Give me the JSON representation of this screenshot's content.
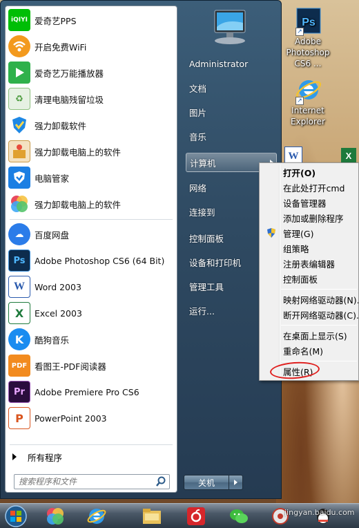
{
  "start_menu": {
    "pinned": [
      {
        "label": "爱奇艺PPS",
        "icon": "iqiyi-icon",
        "color": "#00be06"
      },
      {
        "label": "开启免费WiFi",
        "icon": "wifi-icon",
        "color": "#f39a1e"
      },
      {
        "label": "爱奇艺万能播放器",
        "icon": "player-icon",
        "color": "#2fb14b"
      },
      {
        "label": "清理电脑残留垃圾",
        "icon": "recycle-icon",
        "color": "#4a9a3c"
      },
      {
        "label": "强力卸载软件",
        "icon": "uninstall-icon",
        "color": "#1e88e5"
      },
      {
        "label": "强力卸载电脑上的软件",
        "icon": "uninstall-box-icon",
        "color": "#e0a030"
      },
      {
        "label": "电脑管家",
        "icon": "shield-icon",
        "color": "#1b7fe3"
      },
      {
        "label": "强力卸载电脑上的软件",
        "icon": "colorful-icon",
        "color": "#e84a5f"
      }
    ],
    "recent": [
      {
        "label": "百度网盘",
        "icon": "cloud-icon",
        "color": "#2b7ce9",
        "glyph": "☁"
      },
      {
        "label": "Adobe Photoshop CS6 (64 Bit)",
        "icon": "photoshop-icon",
        "color": "#0d2c4d",
        "glyph": "Ps"
      },
      {
        "label": "Word 2003",
        "icon": "word-icon",
        "color": "#2a5aad",
        "glyph": "W"
      },
      {
        "label": "Excel 2003",
        "icon": "excel-icon",
        "color": "#1e7a3c",
        "glyph": "X"
      },
      {
        "label": "酷狗音乐",
        "icon": "kugou-icon",
        "color": "#1a8cf0",
        "glyph": "K"
      },
      {
        "label": "看图王-PDF阅读器",
        "icon": "pdf-icon",
        "color": "#f28b1f",
        "glyph": "PDF"
      },
      {
        "label": "Adobe Premiere Pro CS6",
        "icon": "premiere-icon",
        "color": "#2a0d3d",
        "glyph": "Pr"
      },
      {
        "label": "PowerPoint 2003",
        "icon": "powerpoint-icon",
        "color": "#d9541e",
        "glyph": "P"
      }
    ],
    "all_programs": "所有程序",
    "search_placeholder": "搜索程序和文件",
    "right": [
      {
        "label": "Administrator"
      },
      {
        "label": "文档"
      },
      {
        "label": "图片"
      },
      {
        "label": "音乐"
      },
      {
        "label": "计算机"
      },
      {
        "label": "网络"
      },
      {
        "label": "连接到"
      },
      {
        "label": "控制面板"
      },
      {
        "label": "设备和打印机"
      },
      {
        "label": "管理工具"
      },
      {
        "label": "运行..."
      }
    ],
    "shutdown": "关机"
  },
  "context_menu": {
    "items": [
      {
        "label": "打开(O)"
      },
      {
        "label": "在此处打开cmd"
      },
      {
        "label": "设备管理器"
      },
      {
        "label": "添加或删除程序"
      },
      {
        "label": "管理(G)"
      },
      {
        "label": "组策略"
      },
      {
        "label": "注册表编辑器"
      },
      {
        "label": "控制面板"
      },
      {
        "label": "映射网络驱动器(N)..."
      },
      {
        "label": "断开网络驱动器(C)..."
      },
      {
        "label": "在桌面上显示(S)"
      },
      {
        "label": "重命名(M)"
      },
      {
        "label": "属性(R)"
      }
    ]
  },
  "desktop": {
    "icons": [
      {
        "label": "Adobe Photoshop CS6 ...",
        "icon": "photoshop-icon"
      },
      {
        "label": "Internet Explorer",
        "icon": "ie-icon"
      }
    ]
  },
  "watermark": "jingyan.baidu.com"
}
